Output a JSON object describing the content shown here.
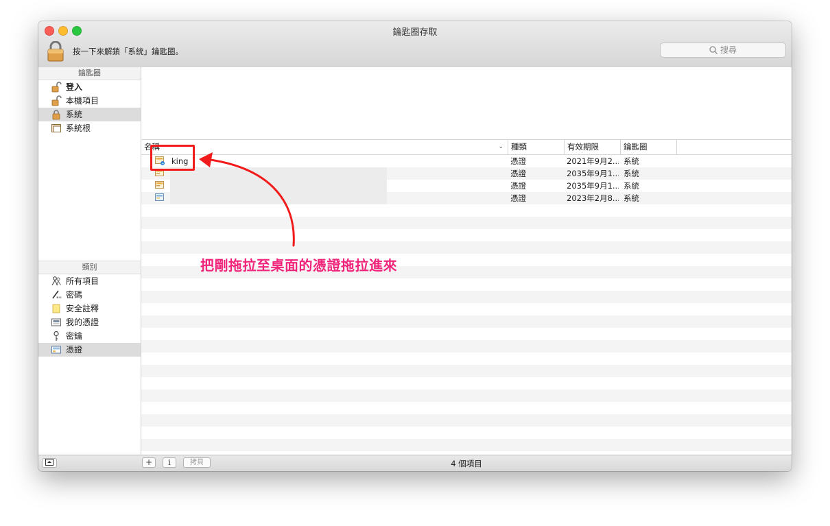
{
  "window": {
    "title": "鑰匙圈存取",
    "unlock_text": "按一下來解鎖「系統」鑰匙圈。",
    "search_placeholder": "搜尋"
  },
  "sidebar": {
    "keychains_header": "鑰匙圈",
    "keychains": [
      {
        "label": "登入",
        "icon": "unlocked-lock-icon",
        "bold": true
      },
      {
        "label": "本機項目",
        "icon": "unlocked-lock-icon"
      },
      {
        "label": "系統",
        "icon": "locked-lock-icon",
        "selected": true
      },
      {
        "label": "系統根",
        "icon": "cabinet-icon"
      }
    ],
    "category_header": "類別",
    "categories": [
      {
        "label": "所有項目",
        "icon": "people-icon"
      },
      {
        "label": "密碼",
        "icon": "pen-icon"
      },
      {
        "label": "安全註釋",
        "icon": "note-icon"
      },
      {
        "label": "我的憑證",
        "icon": "my-cert-icon"
      },
      {
        "label": "密鑰",
        "icon": "key-icon"
      },
      {
        "label": "憑證",
        "icon": "certificate-icon",
        "selected": true
      }
    ]
  },
  "table": {
    "columns": [
      "名稱",
      "種類",
      "有效期限",
      "鑰匙圈"
    ],
    "rows": [
      {
        "name": "king",
        "kind": "憑證",
        "expires": "2021年9月2...",
        "keychain": "系統"
      },
      {
        "name": "",
        "kind": "憑證",
        "expires": "2035年9月1...",
        "keychain": "系統"
      },
      {
        "name": "",
        "kind": "憑證",
        "expires": "2035年9月1...",
        "keychain": "系統"
      },
      {
        "name": "",
        "kind": "憑證",
        "expires": "2023年2月8...",
        "keychain": "系統"
      }
    ]
  },
  "footer": {
    "add": "+",
    "info": "i",
    "copy": "拷貝",
    "count": "4 個項目"
  },
  "annotation": {
    "text": "把剛拖拉至桌面的憑證拖拉進來"
  },
  "colors": {
    "annotation_red": "#f21b1b",
    "annotation_pink": "#f0247a",
    "selected_bg": "#dcdcdc"
  }
}
